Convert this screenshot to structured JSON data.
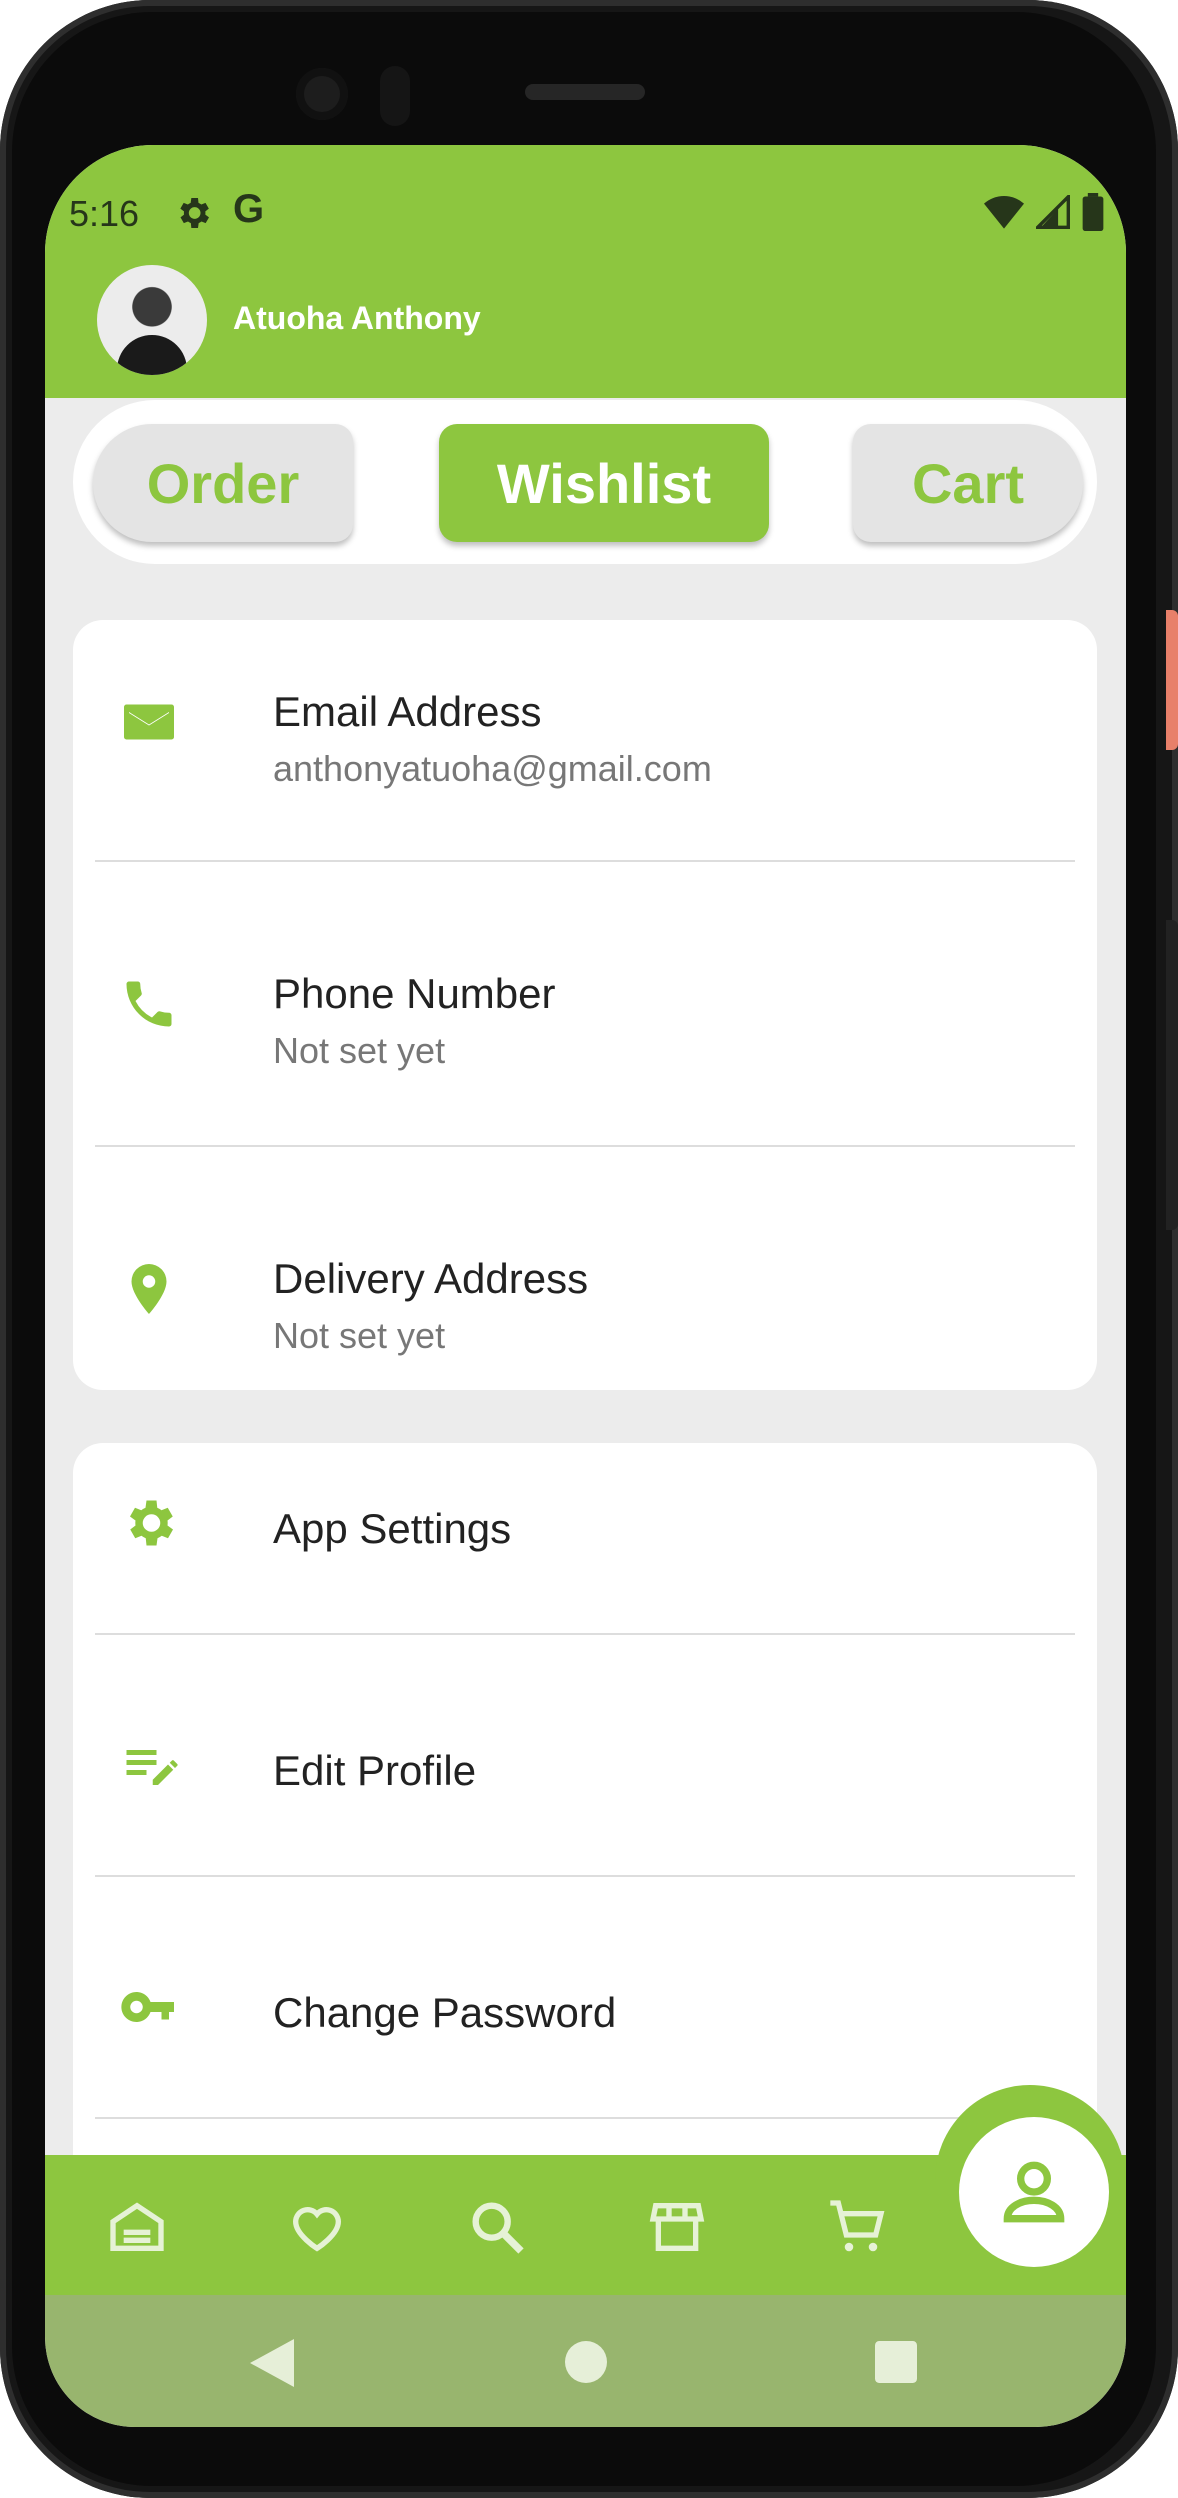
{
  "status_bar": {
    "time": "5:16",
    "google_letter": "G"
  },
  "header": {
    "user_name": "Atuoha Anthony"
  },
  "tabs": [
    {
      "label": "Order"
    },
    {
      "label": "Wishlist"
    },
    {
      "label": "Cart"
    }
  ],
  "contact_card": {
    "items": [
      {
        "title": "Email Address",
        "subtitle": "anthonyatuoha@gmail.com"
      },
      {
        "title": "Phone Number",
        "subtitle": "Not set yet"
      },
      {
        "title": "Delivery Address",
        "subtitle": "Not set yet"
      }
    ]
  },
  "settings_card": {
    "items": [
      {
        "title": "App Settings"
      },
      {
        "title": "Edit Profile"
      },
      {
        "title": "Change Password"
      }
    ]
  },
  "bottom_nav": {
    "items": [
      "home-icon",
      "heart-icon",
      "search-icon",
      "store-icon",
      "cart-icon",
      "profile-icon"
    ],
    "active": "profile-icon"
  },
  "colors": {
    "accent": "#8dc63f",
    "system_nav": "#98b56e",
    "background": "#ececec"
  }
}
